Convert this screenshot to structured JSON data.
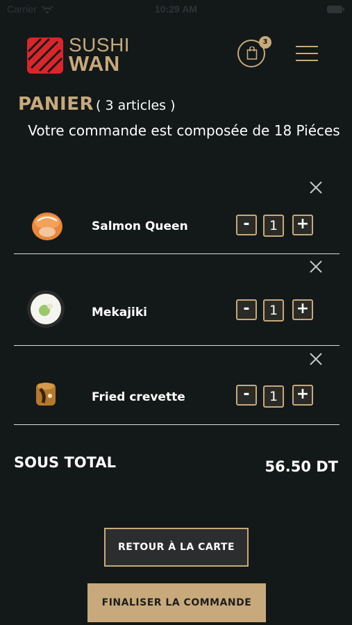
{
  "status_bar": {
    "carrier": "Carrier",
    "time": "10:29 AM"
  },
  "logo": {
    "line1": "SUSHI",
    "line2": "WAN"
  },
  "header": {
    "cart_badge": "3"
  },
  "cart": {
    "title": "PANIER",
    "count": "( 3 articles )",
    "order_message": "Votre commande est composée de 18 Piéces",
    "items": [
      {
        "name": "Salmon Queen",
        "qty": "1",
        "minus": "-",
        "plus": "+"
      },
      {
        "name": "Mekajiki",
        "qty": "1",
        "minus": "-",
        "plus": "+"
      },
      {
        "name": "Fried crevette",
        "qty": "1",
        "minus": "-",
        "plus": "+"
      }
    ],
    "subtotal_label": "SOUS TOTAL",
    "subtotal_value": "56.50 DT"
  },
  "actions": {
    "back_to_menu": "RETOUR À LA CARTE",
    "checkout": "FINALISER LA COMMANDE"
  },
  "colors": {
    "accent": "#c8a97c",
    "background": "#131819",
    "brand_red": "#d9262b"
  }
}
